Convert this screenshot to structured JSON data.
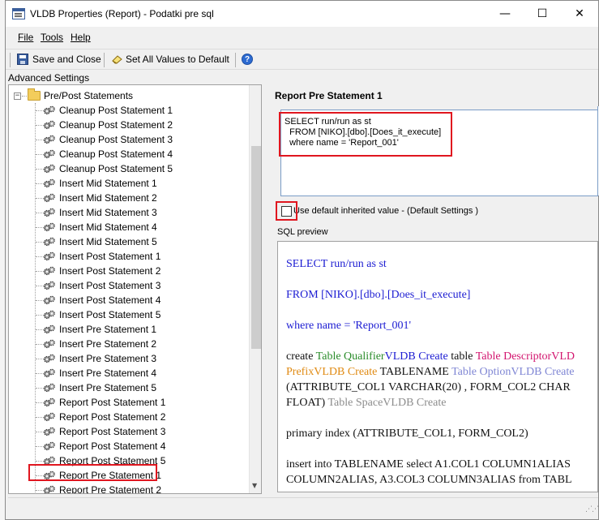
{
  "window": {
    "title": "VLDB Properties (Report) - Podatki pre sql",
    "minimize": "—",
    "maximize": "☐",
    "close": "✕"
  },
  "menu": {
    "file": "File",
    "tools": "Tools",
    "help": "Help"
  },
  "toolbar": {
    "save_label": "Save and Close",
    "set_all_label": "Set All Values to Default",
    "help_icon": "?"
  },
  "advanced_label": "Advanced Settings",
  "tree": {
    "root_label": "Pre/Post Statements",
    "expander": "−",
    "items": [
      "Cleanup Post Statement 1",
      "Cleanup Post Statement 2",
      "Cleanup Post Statement 3",
      "Cleanup Post Statement 4",
      "Cleanup Post Statement 5",
      "Insert Mid Statement 1",
      "Insert Mid Statement 2",
      "Insert Mid Statement 3",
      "Insert Mid Statement 4",
      "Insert Mid Statement 5",
      "Insert Post Statement 1",
      "Insert Post Statement 2",
      "Insert Post Statement 3",
      "Insert Post Statement 4",
      "Insert Post Statement 5",
      "Insert Pre Statement 1",
      "Insert Pre Statement 2",
      "Insert Pre Statement 3",
      "Insert Pre Statement 4",
      "Insert Pre Statement 5",
      "Report Post Statement 1",
      "Report Post Statement 2",
      "Report Post Statement 3",
      "Report Post Statement 4",
      "Report Post Statement 5",
      "Report Pre Statement 1",
      "Report Pre Statement 2"
    ],
    "selected": "Report Pre Statement 1",
    "scroll_down": "▼"
  },
  "right": {
    "title": "Report Pre Statement 1",
    "statement": "SELECT run/run as st\n  FROM [NIKO].[dbo].[Does_it_execute]\n  where name = 'Report_001'",
    "use_default_checked": false,
    "use_default_label": "Use default inherited value - (Default Settings )",
    "sql_preview_label": "SQL preview"
  },
  "sql_preview": {
    "line1": "SELECT run/run as st",
    "line2": "FROM [NIKO].[dbo].[Does_it_execute]",
    "line3": "where name = 'Report_001'",
    "line4_a": "create ",
    "line4_b": "Table Qualifier",
    "line4_c": "VLDB Create",
    "line4_d": " table ",
    "line4_e": "Table Descriptor",
    "line4_f": "VLD",
    "line5_a": "Prefix",
    "line5_b": "VLDB Create",
    "line5_c": " TABLENAME ",
    "line5_d": "Table Option",
    "line5_e": "VLDB Create",
    "line6": "(ATTRIBUTE_COL1 VARCHAR(20) , FORM_COL2 CHAR",
    "line7_a": "FLOAT) ",
    "line7_b": "Table Space",
    "line7_c": "VLDB Create",
    "line8": "primary index (ATTRIBUTE_COL1, FORM_COL2)",
    "line9": "insert into TABLENAME select A1.COL1 COLUMN1ALIAS",
    "line10": "COLUMN2ALIAS, A3.COL3 COLUMN3ALIAS from TABL"
  },
  "colors": {
    "highlight": "#e0161f",
    "sql_keyword_blue": "#1c1cd2",
    "sql_green": "#2a8c2a",
    "sql_magenta": "#d2146e",
    "sql_orange": "#e08a12",
    "sql_lavender": "#7f86d4",
    "sql_gray": "#8c8c8c"
  }
}
